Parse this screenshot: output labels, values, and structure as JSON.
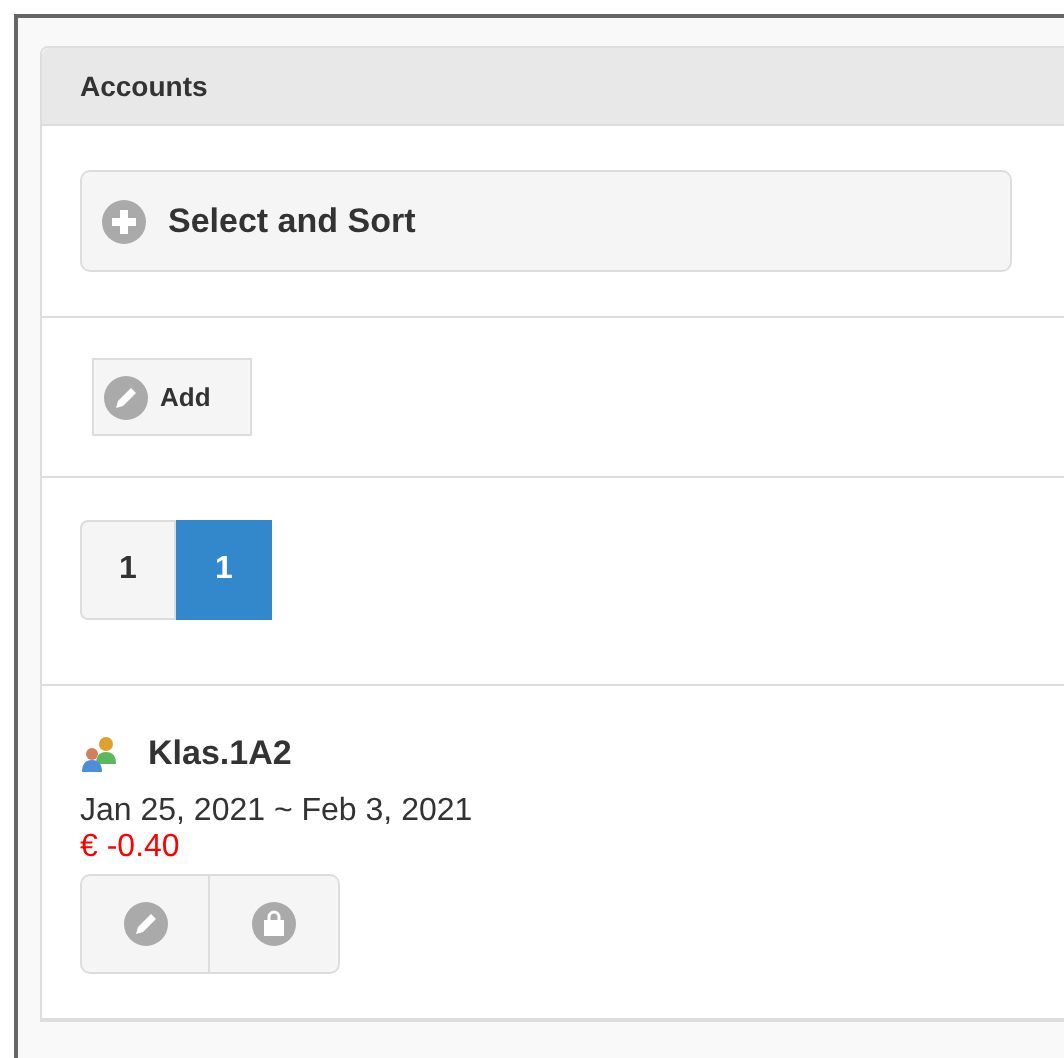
{
  "panel": {
    "title": "Accounts"
  },
  "filter": {
    "label": "Select and Sort",
    "expanded": false
  },
  "toolbar": {
    "add_label": "Add"
  },
  "pager": [
    {
      "label": "1",
      "selected": false
    },
    {
      "label": "1",
      "selected": true
    }
  ],
  "accounts": [
    {
      "name": "Klas.1A2",
      "period": "Jan 25, 2021 ~ Feb 3, 2021",
      "balance": "€ -0.40",
      "negative": true
    }
  ]
}
